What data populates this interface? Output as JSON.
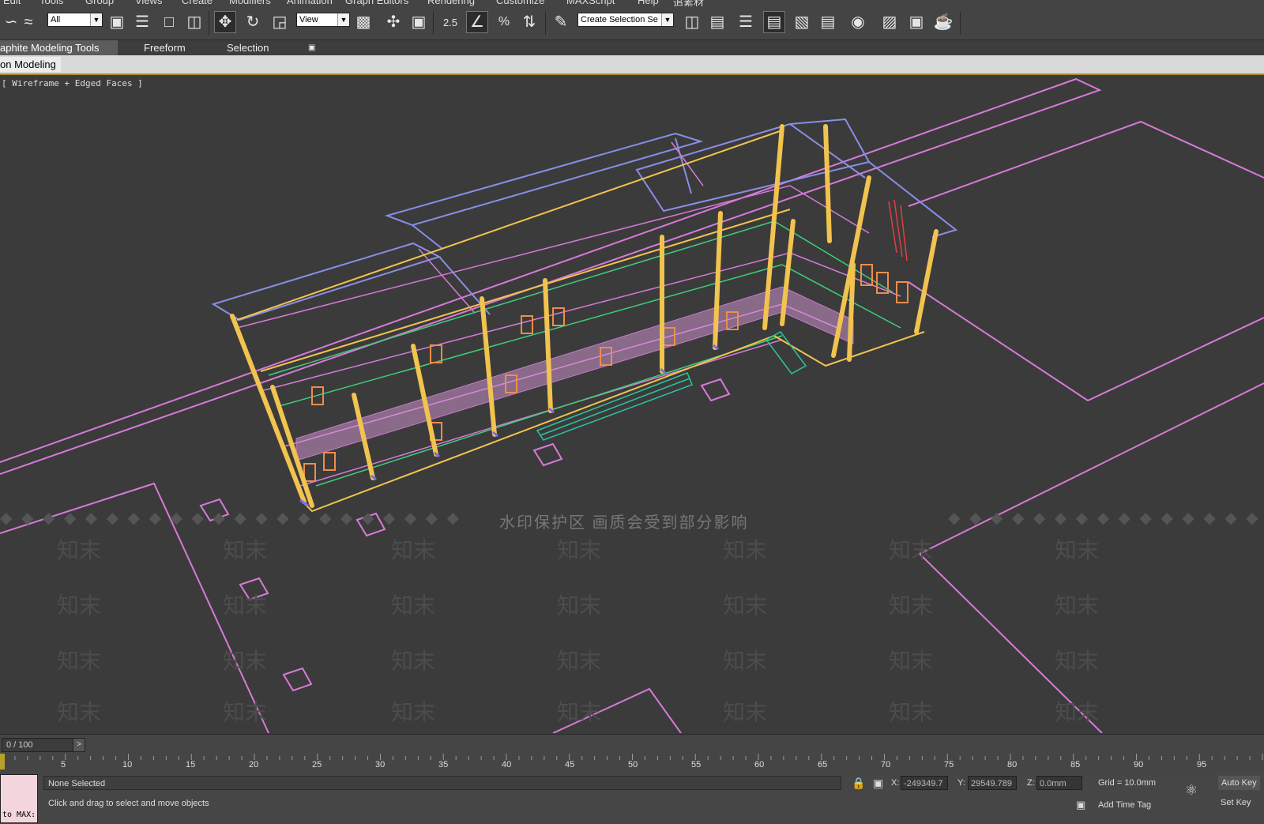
{
  "menu": [
    "Edit",
    "Tools",
    "Group",
    "Views",
    "Create",
    "Modifiers",
    "Animation",
    "Graph Editors",
    "Rendering",
    "Customize",
    "MAXScript",
    "Help",
    "追素材"
  ],
  "toolbar": {
    "selection_filter": "All",
    "reference_coord": "View",
    "snap_angle_label": "2.5",
    "named_selection": "Create Selection Se"
  },
  "ribbon": {
    "tabs": [
      "aphite Modeling Tools",
      "Freeform",
      "Selection"
    ],
    "panel_tab": "on Modeling"
  },
  "viewport": {
    "label": "[ Wireframe + Edged Faces ]",
    "watermark_text": "水印保护区  画质会受到部分影响",
    "watermark_brand": "知末",
    "colors": {
      "background": "#3b3b3b",
      "outline": "#d77ad8",
      "beam": "#f1c34f",
      "blue": "#8a8ee6",
      "green": "#3ecf7a",
      "orange": "#ee8d4a",
      "teal": "#2cc3a0"
    }
  },
  "timeline": {
    "frame_display": "0 / 100",
    "next_label": ">",
    "ticks": [
      "5",
      "10",
      "15",
      "20",
      "25",
      "30",
      "35",
      "40",
      "45",
      "50",
      "55",
      "60",
      "65",
      "70",
      "75",
      "80",
      "85",
      "90",
      "95"
    ]
  },
  "status": {
    "maxscript_label": "to MAX:",
    "selection_status": "None Selected",
    "prompt": "Click and drag to select and move objects",
    "x_label": "X:",
    "x_value": "-249349.7",
    "y_label": "Y:",
    "y_value": "29549.789",
    "z_label": "Z:",
    "z_value": "0.0mm",
    "grid": "Grid = 10.0mm",
    "add_time_tag": "Add Time Tag",
    "auto_key": "Auto Key",
    "set_key": "Set Key"
  }
}
